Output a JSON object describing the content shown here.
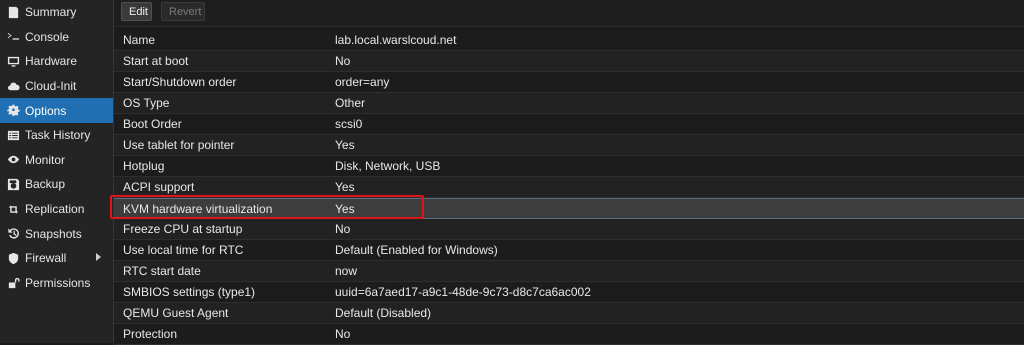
{
  "sidebar": {
    "items": [
      {
        "label": "Summary",
        "icon": "summary-icon"
      },
      {
        "label": "Console",
        "icon": "terminal-icon"
      },
      {
        "label": "Hardware",
        "icon": "monitor-icon"
      },
      {
        "label": "Cloud-Init",
        "icon": "cloud-icon"
      },
      {
        "label": "Options",
        "icon": "gear-icon",
        "active": true
      },
      {
        "label": "Task History",
        "icon": "list-icon"
      },
      {
        "label": "Monitor",
        "icon": "eye-icon"
      },
      {
        "label": "Backup",
        "icon": "floppy-icon"
      },
      {
        "label": "Replication",
        "icon": "retweet-icon"
      },
      {
        "label": "Snapshots",
        "icon": "history-icon"
      },
      {
        "label": "Firewall",
        "icon": "shield-icon",
        "submenu": true
      },
      {
        "label": "Permissions",
        "icon": "unlock-icon"
      }
    ]
  },
  "toolbar": {
    "edit_label": "Edit",
    "revert_label": "Revert"
  },
  "options": {
    "rows": [
      {
        "key": "Name",
        "value": "lab.local.warslcoud.net"
      },
      {
        "key": "Start at boot",
        "value": "No"
      },
      {
        "key": "Start/Shutdown order",
        "value": "order=any"
      },
      {
        "key": "OS Type",
        "value": "Other"
      },
      {
        "key": "Boot Order",
        "value": "scsi0"
      },
      {
        "key": "Use tablet for pointer",
        "value": "Yes"
      },
      {
        "key": "Hotplug",
        "value": "Disk, Network, USB"
      },
      {
        "key": "ACPI support",
        "value": "Yes"
      },
      {
        "key": "KVM hardware virtualization",
        "value": "Yes",
        "selected": true
      },
      {
        "key": "Freeze CPU at startup",
        "value": "No"
      },
      {
        "key": "Use local time for RTC",
        "value": "Default (Enabled for Windows)"
      },
      {
        "key": "RTC start date",
        "value": "now"
      },
      {
        "key": "SMBIOS settings (type1)",
        "value": "uuid=6a7aed17-a9c1-48de-9c73-d8c7ca6ac002"
      },
      {
        "key": "QEMU Guest Agent",
        "value": "Default (Disabled)"
      },
      {
        "key": "Protection",
        "value": "No"
      }
    ]
  },
  "colors": {
    "accent": "#1f6fb2",
    "highlight": "#e0141b",
    "background": "#1b1b1b"
  }
}
